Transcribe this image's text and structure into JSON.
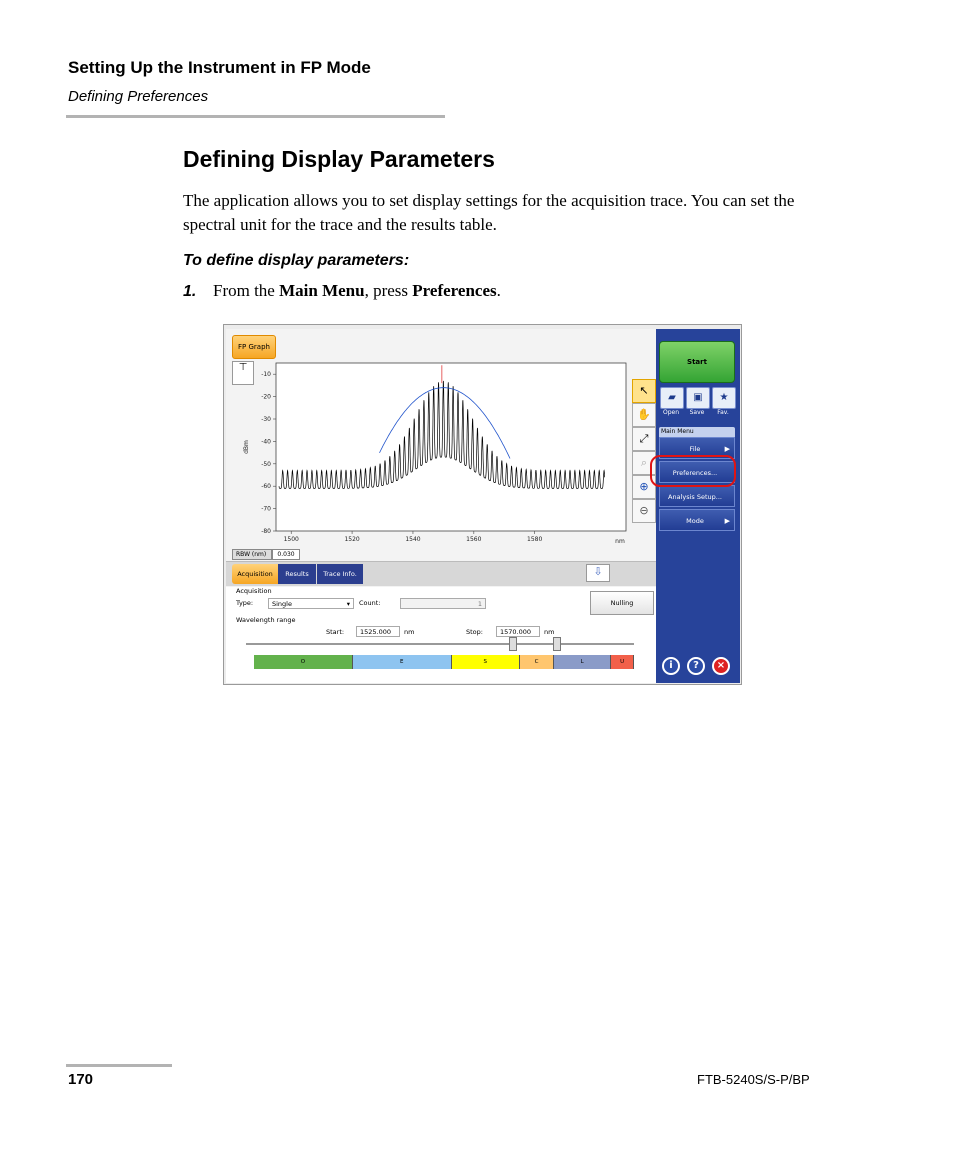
{
  "header": {
    "title": "Setting Up the Instrument in FP Mode",
    "subtitle": "Defining Preferences"
  },
  "section": {
    "title": "Defining Display Parameters",
    "paragraph": "The application allows you to set display settings for the acquisition trace. You can set the spectral unit for the trace and the results table.",
    "procedure_title": "To define display parameters:",
    "step_number": "1.",
    "step_text_a": "From the ",
    "step_bold_1": "Main Menu",
    "step_text_b": ", press ",
    "step_bold_2": "Preferences",
    "step_text_c": "."
  },
  "footer": {
    "page_number": "170",
    "doc_id": "FTB-5240S/S-P/BP"
  },
  "screenshot": {
    "tab_label": "FP Graph",
    "rbw_label": "RBW (nm)",
    "rbw_value": "0.030",
    "tabs": [
      "Acquisition",
      "Results",
      "Trace Info."
    ],
    "acquisition": {
      "heading": "Acquisition",
      "type_label": "Type:",
      "type_value": "Single",
      "count_label": "Count:",
      "count_value": "1",
      "range_label": "Wavelength range",
      "start_label": "Start:",
      "start_value": "1525.000",
      "stop_label": "Stop:",
      "stop_value": "1570.000",
      "unit": "nm",
      "nulling_label": "Nulling",
      "bands": [
        {
          "label": "O",
          "color": "#63b24c"
        },
        {
          "label": "E",
          "color": "#8ec4f0"
        },
        {
          "label": "S",
          "color": "#ffff00"
        },
        {
          "label": "C",
          "color": "#ffc66e"
        },
        {
          "label": "L",
          "color": "#8a9bc8"
        },
        {
          "label": "U",
          "color": "#f2604a"
        }
      ]
    },
    "right_panel": {
      "start_label": "Start",
      "quick_actions": [
        "Open",
        "Save",
        "Fav."
      ],
      "main_menu_title": "Main Menu",
      "menu_items": [
        "File",
        "Preferences...",
        "Analysis Setup...",
        "Mode"
      ],
      "highlight_color": "#e01414"
    },
    "chart_data": {
      "type": "line",
      "xlabel": "nm",
      "ylabel": "dBm",
      "xlim": [
        1495,
        1610
      ],
      "ylim": [
        -80,
        -5
      ],
      "xticks": [
        1500,
        1520,
        1540,
        1560,
        1580
      ],
      "yticks": [
        -10,
        -20,
        -30,
        -40,
        -50,
        -60,
        -70,
        -80
      ],
      "fringe_period_nm": 1.6,
      "envelope_peak": {
        "x": 1550,
        "y": -16
      },
      "envelope_floor": -56,
      "series": [
        {
          "values": "Fabry-Perot fringe spectrum",
          "color": "#000000"
        },
        {
          "values": "Gaussian fit",
          "color": "#2255cc"
        }
      ]
    }
  }
}
